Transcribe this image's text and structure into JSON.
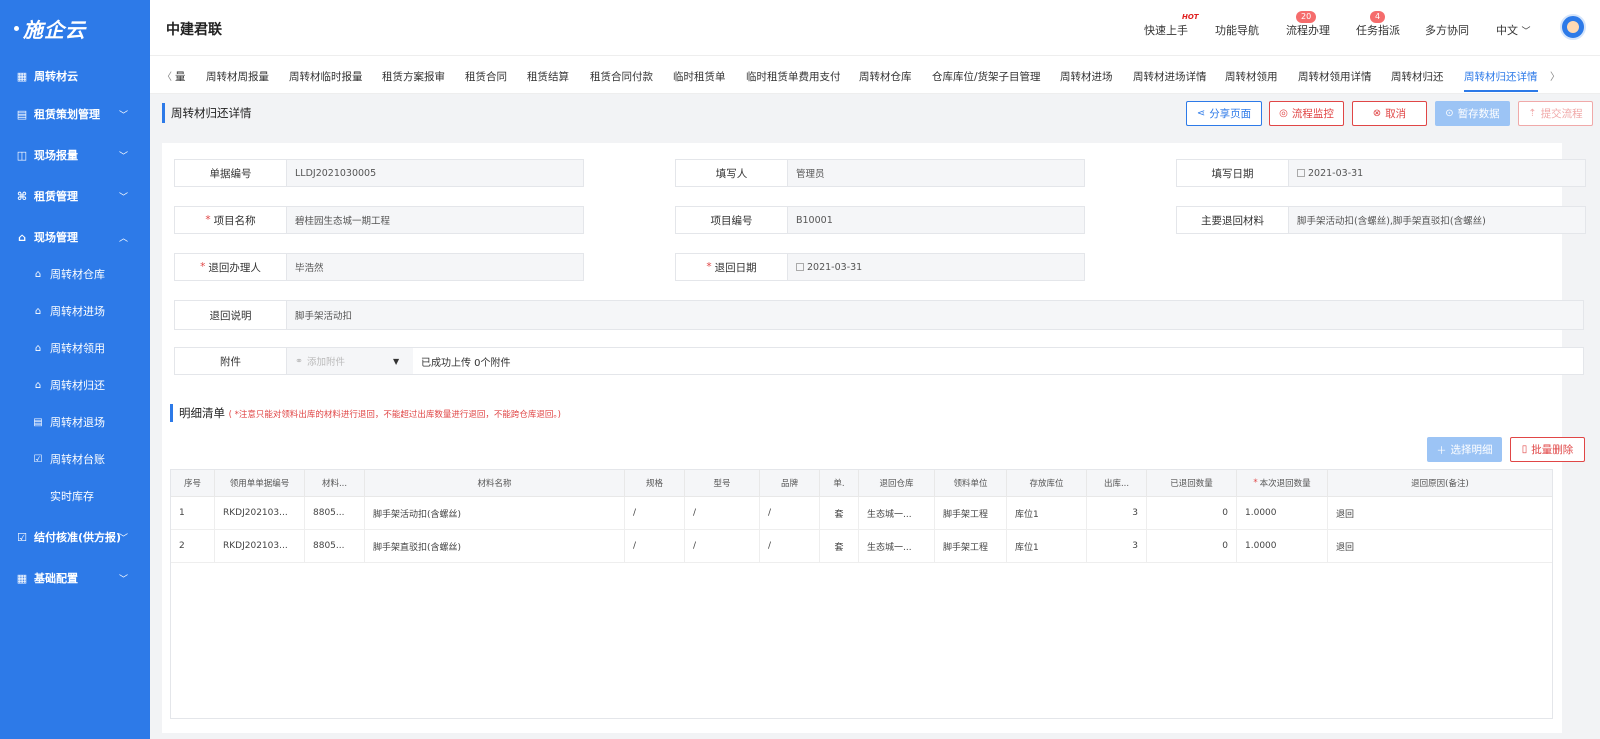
{
  "sidebar": {
    "logo": "施企云",
    "items": [
      {
        "label": "周转材云",
        "icon": "grid-icon"
      },
      {
        "label": "租赁策划管理",
        "icon": "plan-icon"
      },
      {
        "label": "现场报量",
        "icon": "report-icon"
      },
      {
        "label": "租赁管理",
        "icon": "org-icon"
      },
      {
        "label": "现场管理",
        "icon": "home-icon"
      }
    ],
    "subitems": [
      "周转材仓库",
      "周转材进场",
      "周转材领用",
      "周转材归还",
      "周转材退场",
      "周转材台账",
      "实时库存"
    ],
    "bottom_items": [
      {
        "label": "结付核准(供方报)",
        "icon": "check-icon"
      },
      {
        "label": "基础配置",
        "icon": "config-icon"
      }
    ]
  },
  "header": {
    "company": "中建君联",
    "links": [
      "快速上手",
      "功能导航",
      "流程办理",
      "任务指派",
      "多方协同",
      "中文"
    ],
    "hot": "HOT",
    "badges": {
      "flow": "20",
      "task": "4"
    }
  },
  "tabs": [
    "量",
    "周转材周报量",
    "周转材临时报量",
    "租赁方案报审",
    "租赁合同",
    "租赁结算",
    "租赁合同付款",
    "临时租赁单",
    "临时租赁单费用支付",
    "周转材仓库",
    "仓库库位/货架子目管理",
    "周转材进场",
    "周转材进场详情",
    "周转材领用",
    "周转材领用详情",
    "周转材归还",
    "周转材归还详情"
  ],
  "page_title": "周转材归还详情",
  "buttons": {
    "share": "分享页面",
    "monitor": "流程监控",
    "cancel": "取消",
    "save": "暂存数据",
    "submit": "提交流程"
  },
  "form": {
    "doc_no": {
      "label": "单据编号",
      "value": "LLDJ2021030005"
    },
    "filler": {
      "label": "填写人",
      "value": "管理员"
    },
    "fill_date": {
      "label": "填写日期",
      "value": "2021-03-31"
    },
    "project_name": {
      "label": "项目名称",
      "value": "碧桂园生态城一期工程"
    },
    "project_no": {
      "label": "项目编号",
      "value": "B10001"
    },
    "main_material": {
      "label": "主要退回材料",
      "value": "脚手架活动扣(含螺丝),脚手架直驳扣(含螺丝)"
    },
    "handler": {
      "label": "退回办理人",
      "value": "毕浩然"
    },
    "return_date": {
      "label": "退回日期",
      "value": "2021-03-31"
    },
    "remark": {
      "label": "退回说明",
      "value": "脚手架活动扣"
    },
    "attachment": {
      "label": "附件",
      "add": "添加附件",
      "status": "已成功上传 0个附件"
    }
  },
  "detail": {
    "title": "明细清单",
    "note": "( *注意只能对领料出库的材料进行退回，不能超过出库数量进行退回，不能跨仓库退回。)",
    "select_btn": "选择明细",
    "delete_btn": "批量删除",
    "columns": [
      "序号",
      "领用单单据编号",
      "材料...",
      "材料名称",
      "规格",
      "型号",
      "品牌",
      "单.",
      "退回仓库",
      "领料单位",
      "存放库位",
      "出库...",
      "已退回数量",
      "本次退回数量",
      "退回原因(备注)"
    ],
    "rows": [
      [
        "1",
        "RKDJ202103...",
        "8805...",
        "脚手架活动扣(含螺丝)",
        "/",
        "/",
        "/",
        "套",
        "生态城一...",
        "脚手架工程",
        "库位1",
        "3",
        "0",
        "1.0000",
        "退回"
      ],
      [
        "2",
        "RKDJ202103...",
        "8805...",
        "脚手架直驳扣(含螺丝)",
        "/",
        "/",
        "/",
        "套",
        "生态城一...",
        "脚手架工程",
        "库位1",
        "3",
        "0",
        "1.0000",
        "退回"
      ]
    ]
  }
}
